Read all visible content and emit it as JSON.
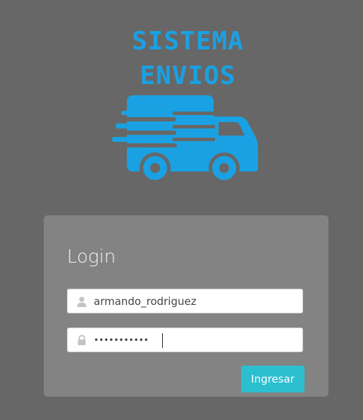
{
  "brand": {
    "line1": "SISTEMA",
    "line2": "ENVIOS",
    "logo_icon": "delivery-truck-icon",
    "color": "#1aa1e3"
  },
  "login": {
    "title": "Login",
    "username": {
      "icon": "user-icon",
      "value": "armando_rodriguez"
    },
    "password": {
      "icon": "lock-icon",
      "value": "•••••••••••"
    },
    "submit_label": "Ingresar",
    "submit_color": "#2bbfd0"
  }
}
